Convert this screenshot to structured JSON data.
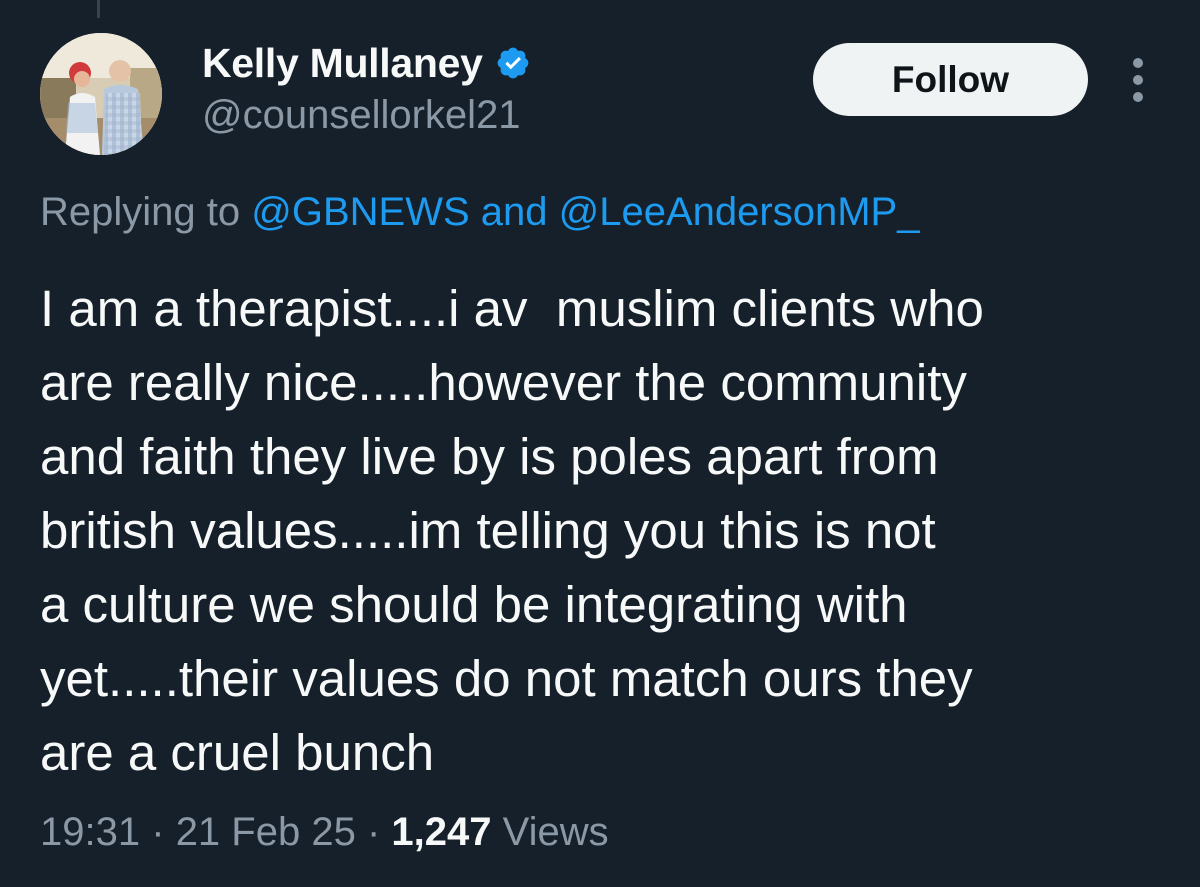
{
  "author": {
    "display_name": "Kelly Mullaney",
    "handle": "@counsellorkel21",
    "verified": true,
    "verified_color": "#1d9bf0"
  },
  "actions": {
    "follow_label": "Follow",
    "more_icon": "more-options-icon"
  },
  "reply": {
    "prefix": "Replying to",
    "mention_1": "@GBNEWS",
    "joiner": "and",
    "mention_2": "@LeeAndersonMP_"
  },
  "tweet": {
    "lines": [
      "I am a therapist....i av  muslim clients who",
      "are really nice.....however the community",
      "and faith they live by is poles apart from",
      "british values.....im telling you this is not",
      "a culture we should be integrating with",
      "yet.....their values do not match ours they",
      "are a cruel bunch"
    ]
  },
  "meta": {
    "time": "19:31",
    "date": "21 Feb 25",
    "separator": "·",
    "views_count": "1,247",
    "views_label": "Views"
  },
  "colors": {
    "background": "#15202b",
    "text_primary": "#f7f9f9",
    "text_secondary": "#8b98a5",
    "link": "#1d9bf0",
    "follow_bg": "#eff3f4"
  }
}
